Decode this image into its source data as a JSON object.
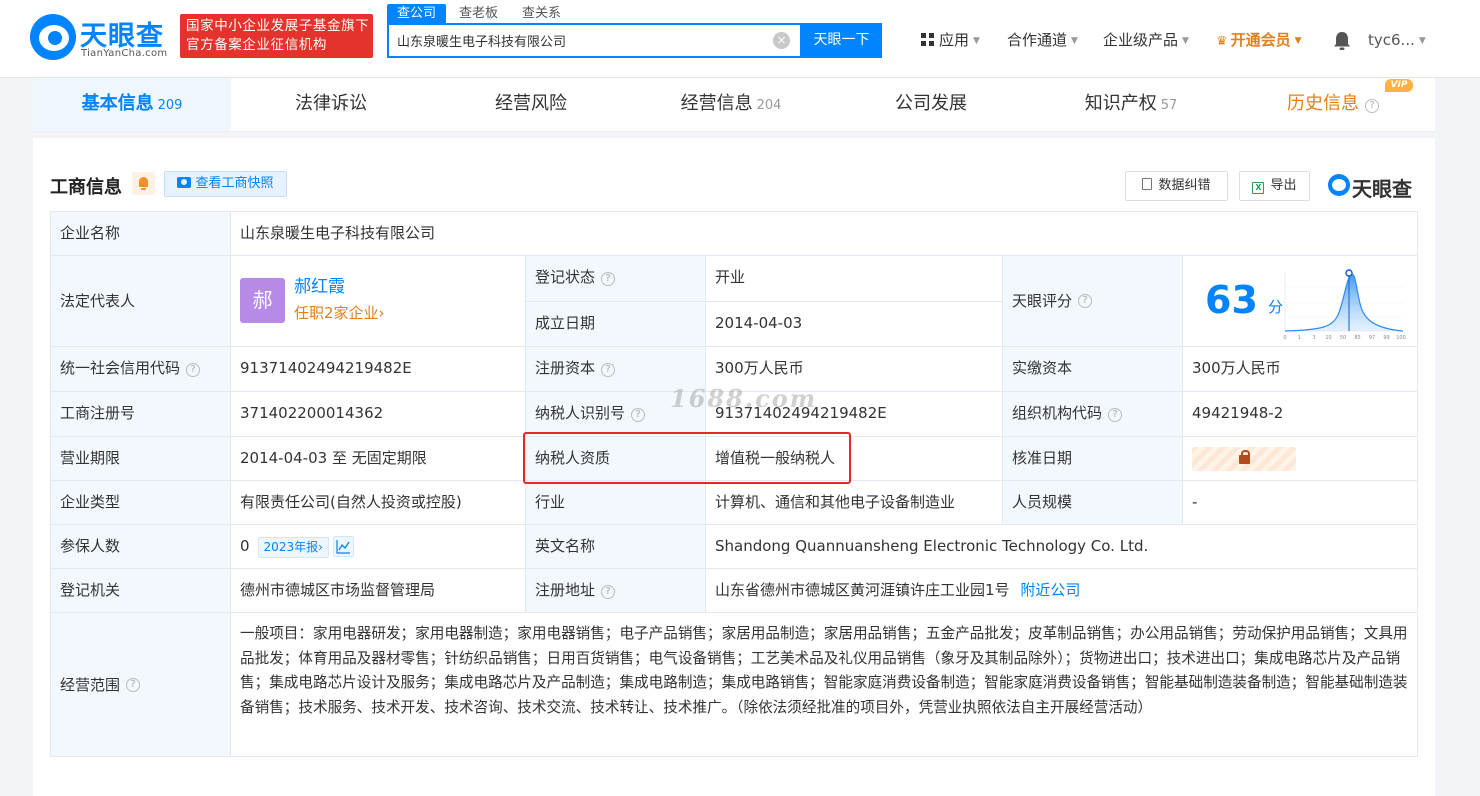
{
  "brand": {
    "name": "天眼查",
    "domain": "TianYanCha.com",
    "accent": "#0084ff"
  },
  "gov_badge": {
    "line1": "国家中小企业发展子基金旗下",
    "line2": "官方备案企业征信机构"
  },
  "search": {
    "tabs": [
      "查公司",
      "查老板",
      "查关系"
    ],
    "value": "山东泉暖生电子科技有限公司",
    "button": "天眼一下"
  },
  "topnav": {
    "apps": "应用",
    "channel": "合作通道",
    "enterprise": "企业级产品",
    "vip": "开通会员",
    "user": "tyc6..."
  },
  "tabs": [
    {
      "label": "基本信息",
      "count": "209"
    },
    {
      "label": "法律诉讼",
      "count": ""
    },
    {
      "label": "经营风险",
      "count": ""
    },
    {
      "label": "经营信息",
      "count": "204"
    },
    {
      "label": "公司发展",
      "count": ""
    },
    {
      "label": "知识产权",
      "count": "57"
    },
    {
      "label": "历史信息",
      "count": "",
      "tag": "VIP"
    }
  ],
  "section": {
    "title": "工商信息",
    "snapshot": "查看工商快照",
    "correct": "数据纠错",
    "export": "导出",
    "brand": "天眼查"
  },
  "info": {
    "company_name_label": "企业名称",
    "company_name": "山东泉暖生电子科技有限公司",
    "legal_rep_label": "法定代表人",
    "legal_rep_avatar": "郝",
    "legal_rep_name": "郝红霞",
    "legal_rep_jobs": "任职2家企业›",
    "status_label": "登记状态",
    "status": "开业",
    "founded_label": "成立日期",
    "founded": "2014-04-03",
    "score_label": "天眼评分",
    "score": "63",
    "score_unit": "分",
    "score_ticks": [
      "0",
      "1",
      "3",
      "10",
      "50",
      "85",
      "97",
      "99",
      "100"
    ],
    "credit_code_label": "统一社会信用代码",
    "credit_code": "91371402494219482E",
    "reg_capital_label": "注册资本",
    "reg_capital": "300万人民币",
    "paid_capital_label": "实缴资本",
    "paid_capital": "300万人民币",
    "reg_no_label": "工商注册号",
    "reg_no": "371402200014362",
    "taxpayer_id_label": "纳税人识别号",
    "taxpayer_id": "91371402494219482E",
    "org_code_label": "组织机构代码",
    "org_code": "49421948-2",
    "term_label": "营业期限",
    "term": "2014-04-03 至 无固定期限",
    "tax_qual_label": "纳税人资质",
    "tax_qual": "增值税一般纳税人",
    "approval_label": "核准日期",
    "company_type_label": "企业类型",
    "company_type": "有限责任公司(自然人投资或控股)",
    "industry_label": "行业",
    "industry": "计算机、通信和其他电子设备制造业",
    "staff_size_label": "人员规模",
    "staff_size": "-",
    "insured_label": "参保人数",
    "insured": "0",
    "insured_report": "2023年报›",
    "english_name_label": "英文名称",
    "english_name": "Shandong Quannuansheng Electronic Technology Co. Ltd.",
    "authority_label": "登记机关",
    "authority": "德州市德城区市场监督管理局",
    "address_label": "注册地址",
    "address": "山东省德州市德城区黄河涯镇许庄工业园1号",
    "nearby": "附近公司",
    "scope_label": "经营范围",
    "scope": "一般项目：家用电器研发；家用电器制造；家用电器销售；电子产品销售；家居用品制造；家居用品销售；五金产品批发；皮革制品销售；办公用品销售；劳动保护用品销售；文具用品批发；体育用品及器材零售；针纺织品销售；日用百货销售；电气设备销售；工艺美术品及礼仪用品销售（象牙及其制品除外）；货物进出口；技术进出口；集成电路芯片及产品销售；集成电路芯片设计及服务；集成电路芯片及产品制造；集成电路制造；集成电路销售；智能家庭消费设备制造；智能家庭消费设备销售；智能基础制造装备制造；智能基础制造装备销售；技术服务、技术开发、技术咨询、技术交流、技术转让、技术推广。（除依法须经批准的项目外，凭营业执照依法自主开展经营活动）"
  },
  "watermark": "1688.com"
}
